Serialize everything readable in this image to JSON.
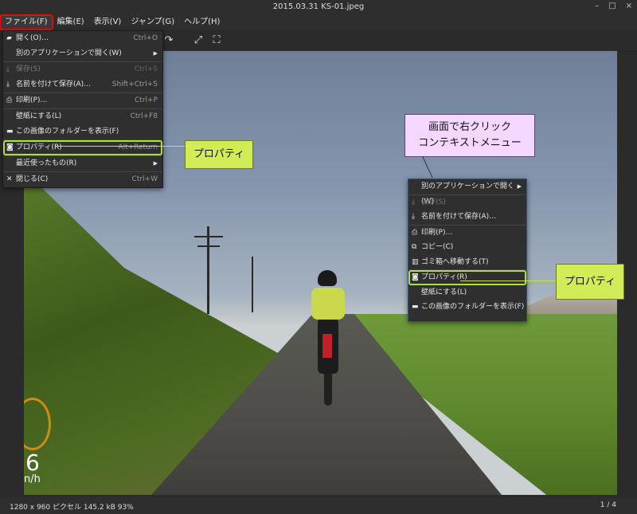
{
  "window": {
    "title": "2015.03.31 KS-01.jpeg",
    "buttons": [
      "–",
      "□",
      "×"
    ]
  },
  "menubar": [
    {
      "label": "ファイル(F)",
      "active": true
    },
    {
      "label": "編集(E)"
    },
    {
      "label": "表示(V)"
    },
    {
      "label": "ジャンプ(G)"
    },
    {
      "label": "ヘルプ(H)"
    }
  ],
  "file_menu": {
    "open": {
      "label": "開く(O)…",
      "shortcut": "Ctrl+O"
    },
    "open_with": {
      "label": "別のアプリケーションで開く(W)"
    },
    "save": {
      "label": "保存(S)",
      "shortcut": "Ctrl+S"
    },
    "save_as": {
      "label": "名前を付けて保存(A)…",
      "shortcut": "Shift+Ctrl+S"
    },
    "print": {
      "label": "印刷(P)…",
      "shortcut": "Ctrl+P"
    },
    "wallpaper": {
      "label": "壁紙にする(L)",
      "shortcut": "Ctrl+F8"
    },
    "show_folder": {
      "label": "この画像のフォルダーを表示(F)"
    },
    "properties": {
      "label": "プロパティ(R)",
      "shortcut": "Alt+Return"
    },
    "recent": {
      "label": "最近使ったもの(R)"
    },
    "close": {
      "label": "閉じる(C)",
      "shortcut": "Ctrl+W"
    }
  },
  "context_menu": {
    "open_with": "別のアプリケーションで開く(W)",
    "save": "保存(S)",
    "save_as": "名前を付けて保存(A)…",
    "print": "印刷(P)…",
    "copy": "コピー(C)",
    "trash": "ゴミ箱へ移動する(T)",
    "properties": "プロパティ(R)",
    "wallpaper": "壁紙にする(L)",
    "show_folder": "この画像のフォルダーを表示(F)"
  },
  "annotations": {
    "callout_file_menu": "プロパティ",
    "callout_context_menu": "プロパティ",
    "bubble_line1": "画面で右クリック",
    "bubble_line2": "コンテキストメニュー"
  },
  "overlay": {
    "speed": "6",
    "unit": "n/h"
  },
  "statusbar": {
    "info": "1280 x 960 ピクセル 145.2 kB    93%",
    "page": "1 / 4"
  },
  "colors": {
    "highlight": "#aee03a",
    "active_menu_outline": "#e01010",
    "callout_bg": "#d2ec58",
    "bubble_bg": "#f6d7ff"
  }
}
